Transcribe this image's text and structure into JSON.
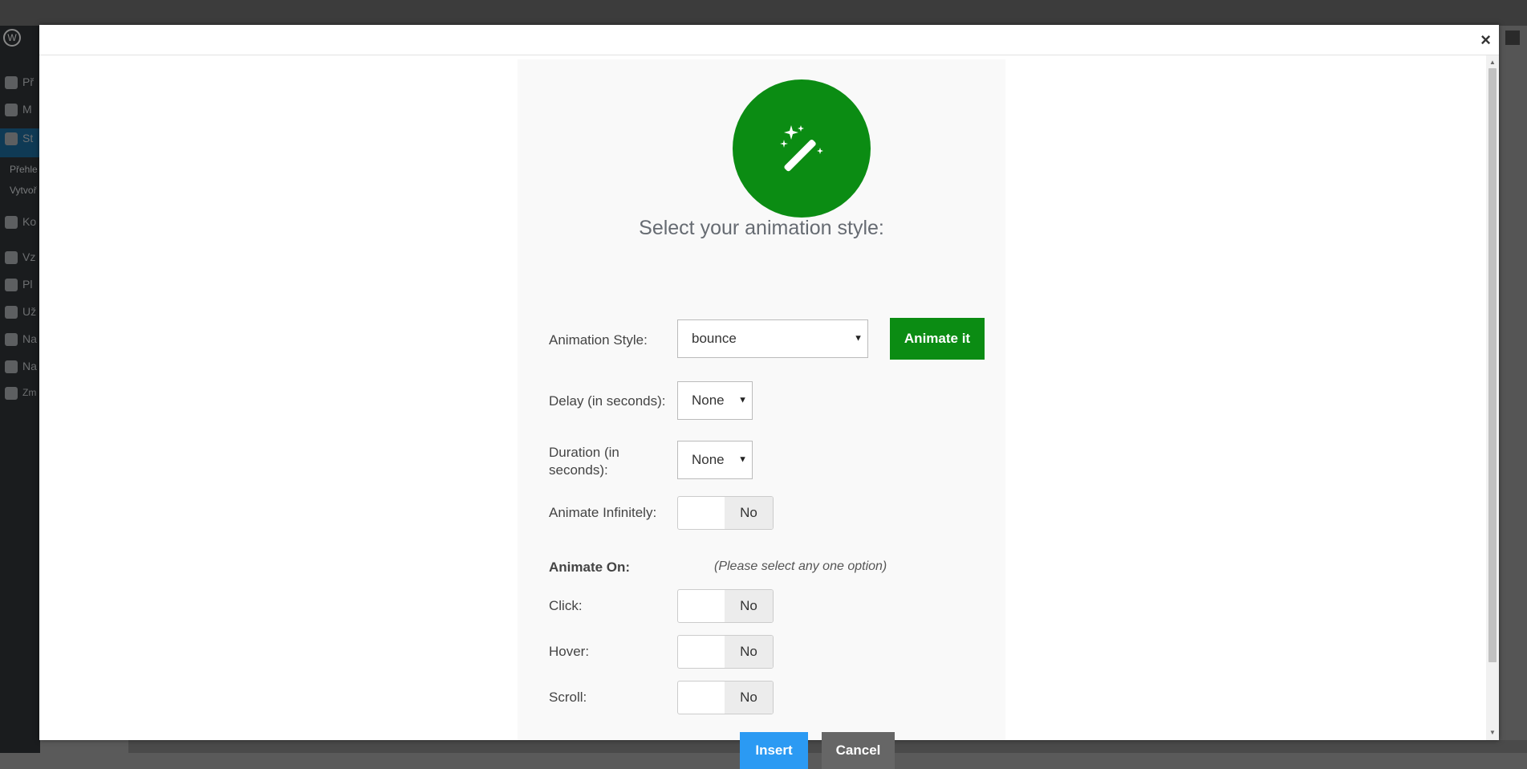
{
  "backdrop": {
    "sidebar_items": [
      "Př",
      "M",
      "St",
      "Ko",
      "Vz",
      "Pl",
      "Už",
      "Na",
      "Na",
      "Zm"
    ],
    "sidebar_sub": [
      "Přehle",
      "Vytvoř"
    ]
  },
  "modal": {
    "close_label": "×"
  },
  "form": {
    "title": "Select your animation style:",
    "animation_style_label": "Animation Style:",
    "animation_style_value": "bounce",
    "animate_button": "Animate it",
    "delay_label": "Delay (in seconds):",
    "delay_value": "None",
    "duration_label": "Duration (in seconds):",
    "duration_value": "None",
    "infinite_label": "Animate Infinitely:",
    "infinite_value": "No",
    "animate_on_label": "Animate On:",
    "animate_on_hint": "(Please select any one option)",
    "click_label": "Click:",
    "click_value": "No",
    "hover_label": "Hover:",
    "hover_value": "No",
    "scroll_label": "Scroll:",
    "scroll_value": "No",
    "insert_button": "Insert",
    "cancel_button": "Cancel"
  },
  "colors": {
    "accent_green": "#0b8c13",
    "insert_blue": "#2b9af3",
    "cancel_gray": "#666666"
  },
  "icons": {
    "logo": "magic-wand-icon",
    "close": "close-icon"
  }
}
